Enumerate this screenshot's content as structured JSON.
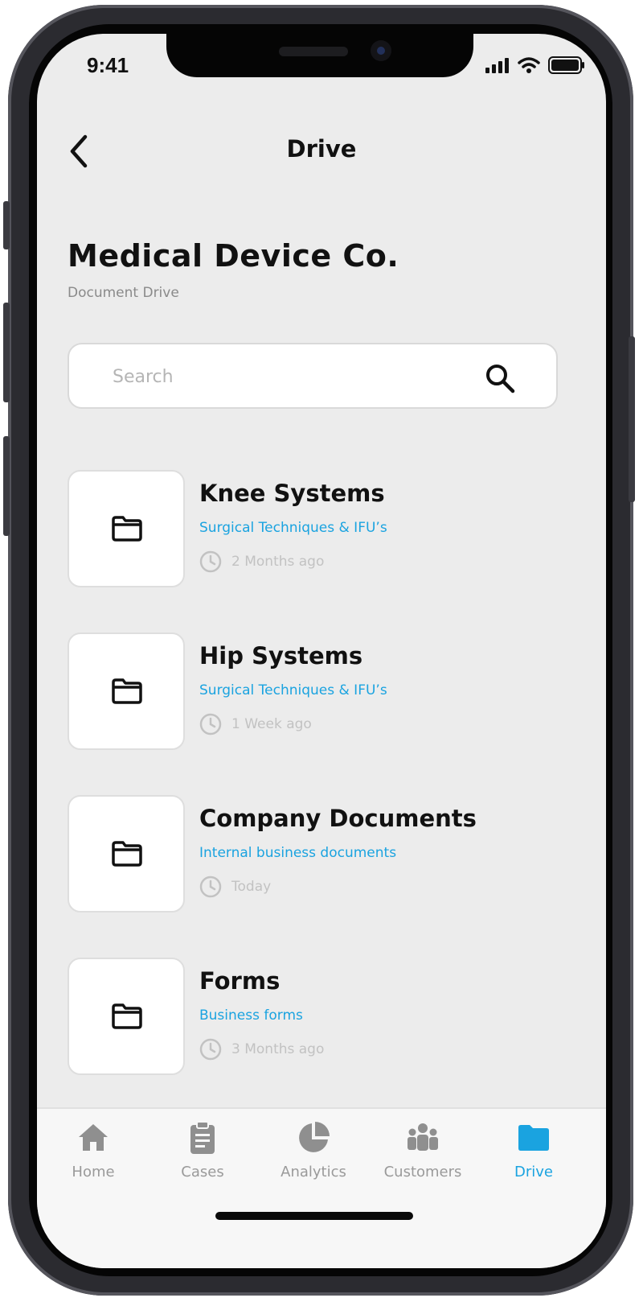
{
  "status_bar": {
    "time": "9:41"
  },
  "header": {
    "title": "Drive",
    "back_icon": "chevron-left-icon"
  },
  "company": {
    "name": "Medical Device Co.",
    "subtitle": "Document Drive"
  },
  "search": {
    "placeholder": "Search",
    "value": "",
    "icon": "search-icon"
  },
  "folders": [
    {
      "name": "Knee Systems",
      "description": "Surgical Techniques & IFU’s",
      "updated": "2 Months ago"
    },
    {
      "name": "Hip Systems",
      "description": "Surgical Techniques & IFU’s",
      "updated": "1 Week ago"
    },
    {
      "name": "Company Documents",
      "description": "Internal business documents",
      "updated": "Today"
    },
    {
      "name": "Forms",
      "description": "Business forms",
      "updated": "3 Months ago"
    }
  ],
  "tabs": [
    {
      "label": "Home",
      "icon": "home-icon",
      "active": false
    },
    {
      "label": "Cases",
      "icon": "clipboard-icon",
      "active": false
    },
    {
      "label": "Analytics",
      "icon": "pie-chart-icon",
      "active": false
    },
    {
      "label": "Customers",
      "icon": "people-icon",
      "active": false
    },
    {
      "label": "Drive",
      "icon": "folder-icon",
      "active": true
    }
  ],
  "colors": {
    "accent": "#1aa3e0",
    "muted_text": "#c2c2c2",
    "background": "#ececec",
    "tab_inactive": "#9a9a9a"
  }
}
